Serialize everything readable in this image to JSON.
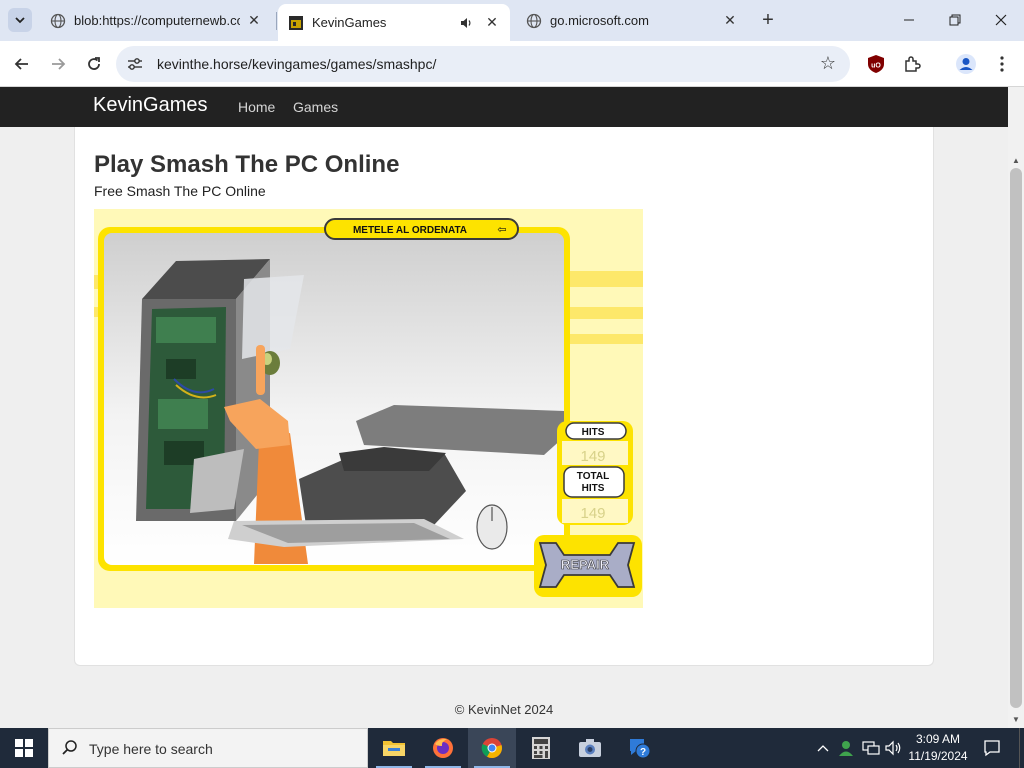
{
  "browser": {
    "tabs": [
      {
        "title": "blob:https://computernewb.com",
        "active": false
      },
      {
        "title": "KevinGames",
        "active": true,
        "audio": true
      },
      {
        "title": "go.microsoft.com",
        "active": false
      }
    ],
    "url": "kevinthe.horse/kevingames/games/smashpc/"
  },
  "site": {
    "brand": "KevinGames",
    "nav": [
      {
        "label": "Home"
      },
      {
        "label": "Games"
      }
    ],
    "footer": "© KevinNet 2024"
  },
  "page": {
    "title": "Play Smash The PC Online",
    "subtitle": "Free Smash The PC Online"
  },
  "game": {
    "banner": "METELE AL ORDENATA",
    "hits_label": "HITS",
    "hits_value": "149",
    "total_label_1": "TOTAL",
    "total_label_2": "HITS",
    "total_value": "149",
    "repair_label": "REPAIR"
  },
  "taskbar": {
    "search_placeholder": "Type here to search",
    "time": "3:09 AM",
    "date": "11/19/2024"
  },
  "colors": {
    "game_yellow": "#fde300",
    "game_pale": "#fff9b8",
    "nav_dark": "#222222",
    "tabstrip": "#dfe6f3",
    "taskbar": "#1f2a3a"
  }
}
